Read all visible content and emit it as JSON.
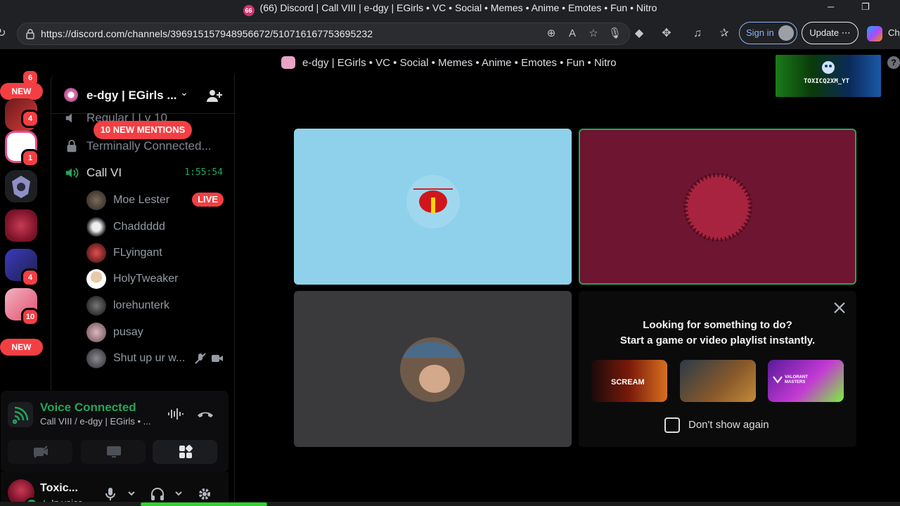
{
  "window": {
    "tab_badge": "66",
    "title": "(66) Discord | Call VIII | e-dgy | EGirls • VC • Social • Memes • Anime • Emotes • Fun • Nitro"
  },
  "browser": {
    "url": "https://discord.com/channels/396915157948956672/510716167753695232",
    "sign_in_label": "Sign in",
    "update_label": "Update",
    "update_more": "⋯",
    "partial_tab_label": "Ch"
  },
  "server_title_bar": "e-dgy | EGirls • VC • Social • Memes • Anime • Emotes • Fun • Nitro",
  "overlay": {
    "channel_name": "TOXICQ2XM_YT"
  },
  "guilds": {
    "new_top": "NEW",
    "new_bottom": "NEW",
    "badges": [
      "6",
      "4",
      "1",
      "4",
      "10"
    ]
  },
  "sidebar": {
    "server_name": "e-dgy | EGirls ...",
    "channels": [
      {
        "name": "Regular | Lv 10",
        "type": "voice"
      },
      {
        "name": "Terminally Connected...",
        "type": "locked"
      },
      {
        "name": "Call VI",
        "type": "voice",
        "timer": "1:55:54"
      }
    ],
    "mentions_pill": "10 NEW MENTIONS",
    "members": [
      {
        "name": "Moe Lester",
        "live": "LIVE"
      },
      {
        "name": "Chaddddd"
      },
      {
        "name": "FLyingant"
      },
      {
        "name": "HolyTweaker"
      },
      {
        "name": "lorehunterk"
      },
      {
        "name": "pusay"
      },
      {
        "name": "Shut up ur w..."
      }
    ]
  },
  "voice_panel": {
    "status": "Voice Connected",
    "channel": "Call VIII / e-dgy | EGirls • ..."
  },
  "user_panel": {
    "username": "Toxic...",
    "state": "In voice"
  },
  "activity": {
    "heading_line1": "Looking for something to do?",
    "heading_line2": "Start a game or video playlist instantly.",
    "games": [
      "scream",
      "cozy-game",
      "valorant-masters"
    ],
    "dont_show_label": "Don't show again"
  },
  "colors": {
    "accent_green": "#23a55a",
    "danger_red": "#f23f43",
    "link_blue": "#8ab4f8"
  }
}
